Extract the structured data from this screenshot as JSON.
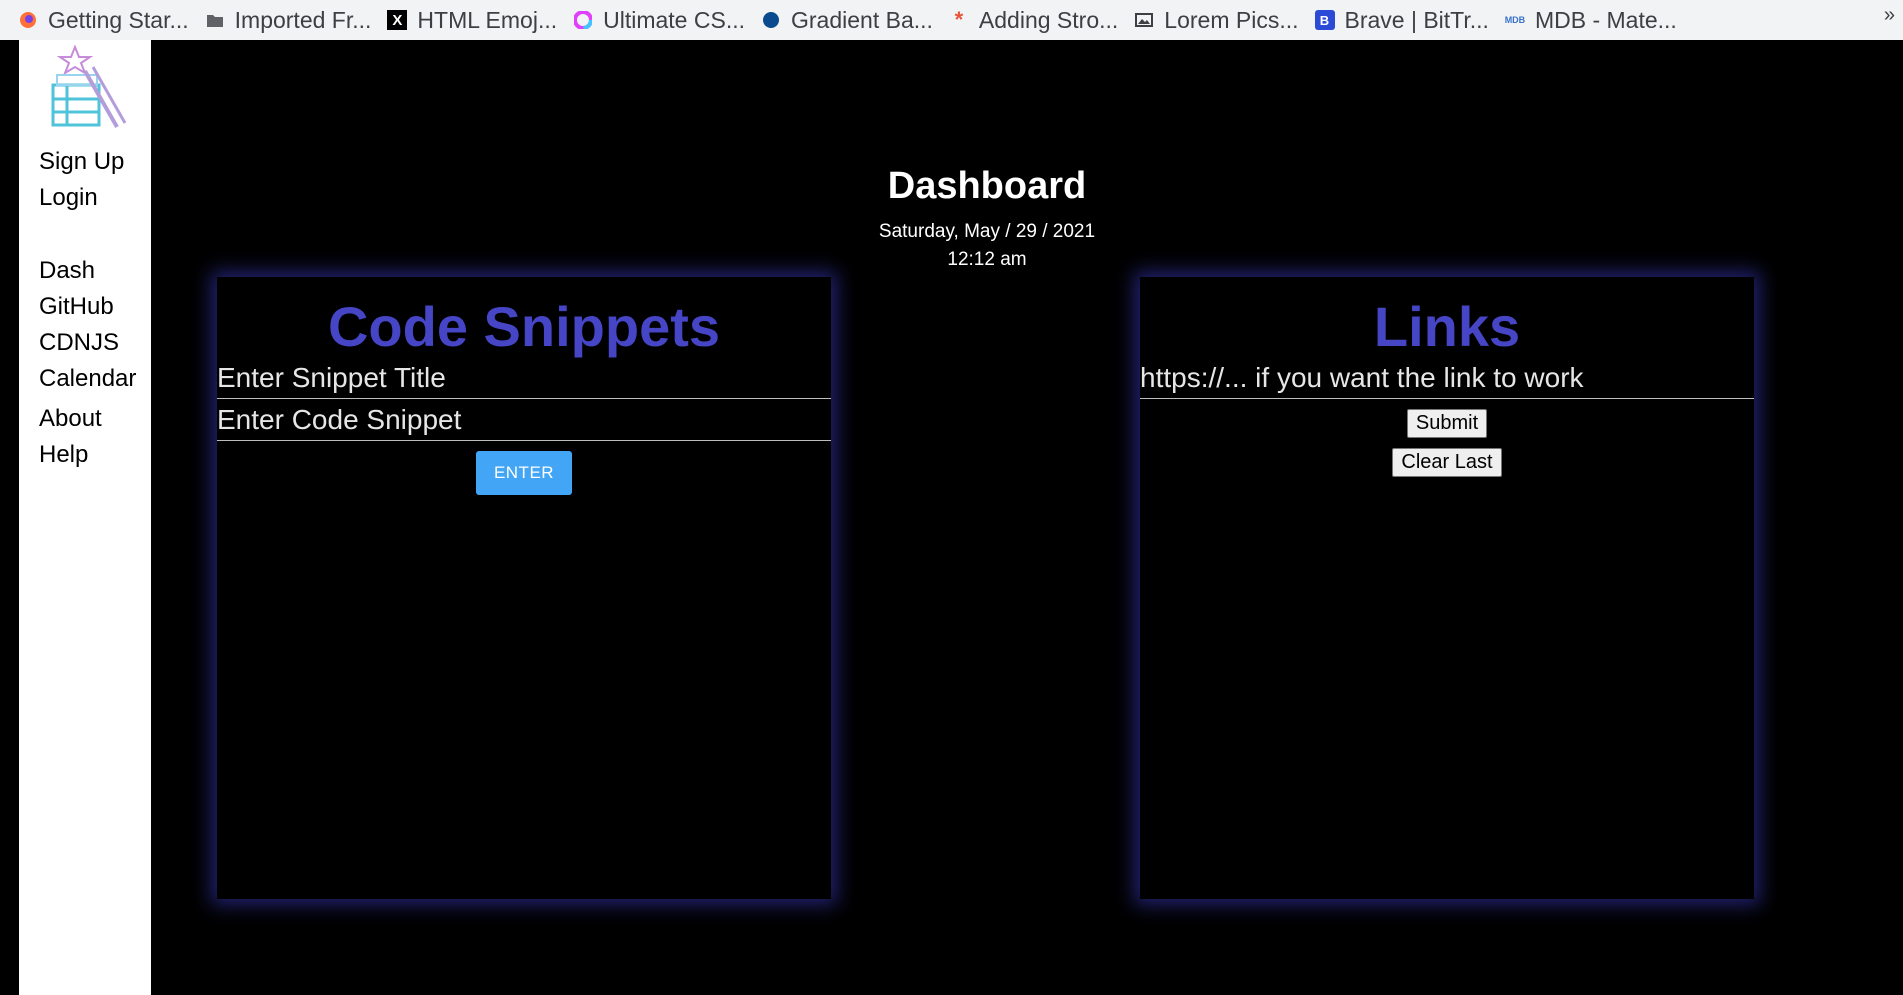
{
  "bookmarks": [
    {
      "label": "Getting Star...",
      "icon": "firefox-icon"
    },
    {
      "label": "Imported Fr...",
      "icon": "folder-icon"
    },
    {
      "label": "HTML Emoj...",
      "icon": "x-icon"
    },
    {
      "label": "Ultimate CS...",
      "icon": "color-wheel-icon"
    },
    {
      "label": "Gradient Ba...",
      "icon": "circle-icon"
    },
    {
      "label": "Adding Stro...",
      "icon": "asterisk-icon"
    },
    {
      "label": "Lorem Pics...",
      "icon": "image-icon"
    },
    {
      "label": "Brave | BitTr...",
      "icon": "brave-icon"
    },
    {
      "label": "MDB - Mate...",
      "icon": "mdb-icon"
    }
  ],
  "overflow": "»",
  "sidebar": {
    "auth": [
      "Sign Up",
      "Login"
    ],
    "nav": [
      "Dash",
      "GitHub",
      "CDNJS",
      "Calendar"
    ],
    "info": [
      "About",
      "Help"
    ]
  },
  "dashboard": {
    "title": "Dashboard",
    "date": "Saturday, May / 29 / 2021",
    "time": "12:12 am"
  },
  "snippets": {
    "title": "Code Snippets",
    "title_placeholder": "Enter Snippet Title",
    "code_placeholder": "Enter Code Snippet",
    "enter_label": "ENTER"
  },
  "links": {
    "title": "Links",
    "url_placeholder": "https://... if you want the link to work",
    "submit_label": "Submit",
    "clear_label": "Clear Last"
  },
  "colors": {
    "accent": "#4545c6",
    "enter_button": "#42a5f5",
    "background": "#000000"
  }
}
